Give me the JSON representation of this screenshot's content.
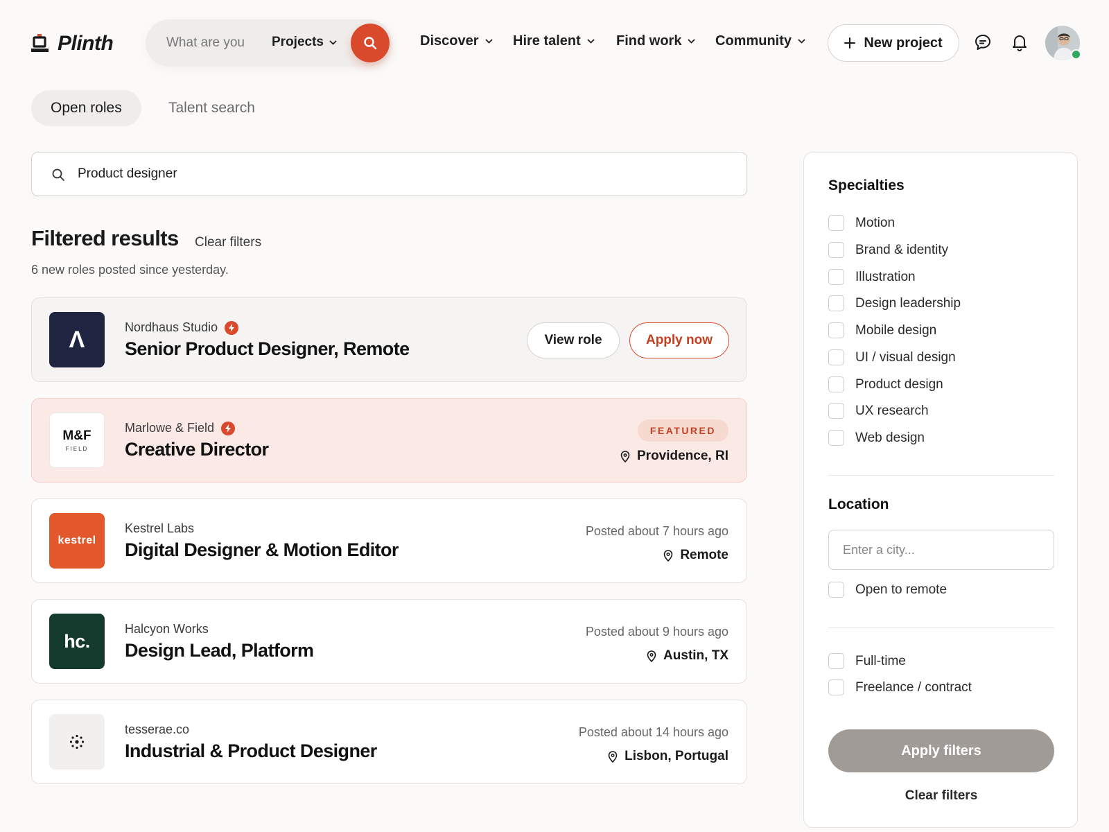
{
  "app": {
    "name": "Plinth"
  },
  "header": {
    "search": {
      "placeholder": "What are you",
      "scope_label": "Projects"
    },
    "nav": [
      {
        "label": "Discover"
      },
      {
        "label": "Hire talent"
      },
      {
        "label": "Find work"
      },
      {
        "label": "Community"
      }
    ],
    "new_project_label": "New project"
  },
  "tabs": [
    {
      "label": "Open roles",
      "active": true
    },
    {
      "label": "Talent search",
      "active": false
    }
  ],
  "main": {
    "search_value": "Product designer",
    "results_title": "Filtered results",
    "clear_filters_label": "Clear filters",
    "subtitle": "6 new roles posted since yesterday."
  },
  "jobs": [
    {
      "company": "Nordhaus Studio",
      "verified": true,
      "title": "Senior Product Designer, Remote",
      "logo_text": "Λ",
      "logo_bg": "#1f2540",
      "view_label": "View role",
      "apply_label": "Apply now"
    },
    {
      "company": "Marlowe & Field",
      "verified": true,
      "title": "Creative Director",
      "logo_text": "M&F",
      "logo_subtext": "FIELD",
      "logo_bg": "#ffffff",
      "badge": "FEATURED",
      "location": "Providence, RI"
    },
    {
      "company": "Kestrel Labs",
      "title": "Digital Designer & Motion Editor",
      "logo_text": "kestrel",
      "logo_bg": "#e2572b",
      "posted": "Posted about 7 hours ago",
      "location": "Remote"
    },
    {
      "company": "Halcyon Works",
      "title": "Design Lead, Platform",
      "logo_text": "hc.",
      "logo_bg": "#143a2e",
      "posted": "Posted about 9 hours ago",
      "location": "Austin, TX"
    },
    {
      "company": "tesserae.co",
      "title": "Industrial & Product Designer",
      "logo_bg": "#f1f0ee",
      "posted": "Posted about 14 hours ago",
      "location": "Lisbon, Portugal"
    }
  ],
  "sidebar": {
    "specialties_title": "Specialties",
    "specialties": [
      {
        "label": "Motion",
        "checked": false
      },
      {
        "label": "Brand & identity",
        "checked": false
      },
      {
        "label": "Illustration",
        "checked": false
      },
      {
        "label": "Design leadership",
        "checked": false
      },
      {
        "label": "Mobile design",
        "checked": false
      },
      {
        "label": "UI / visual design",
        "checked": false
      },
      {
        "label": "Product design",
        "checked": false
      },
      {
        "label": "UX research",
        "checked": false
      },
      {
        "label": "Web design",
        "checked": false
      }
    ],
    "location_title": "Location",
    "city_placeholder": "Enter a city...",
    "open_to_remote_label": "Open to remote",
    "job_types": [
      {
        "label": "Full-time",
        "checked": false
      },
      {
        "label": "Freelance / contract",
        "checked": false
      }
    ],
    "apply_label": "Apply filters",
    "clear_label": "Clear filters"
  },
  "colors": {
    "accent": "#d94a2c",
    "featured_bg": "#fbe9e6",
    "presence": "#2fa860",
    "apply_filters_bg": "#a09b97"
  },
  "icons": {
    "logo": "stamp-icon",
    "search": "search-icon",
    "chevron": "chevron-down-icon",
    "plus": "plus-icon",
    "messages": "chat-bubble-icon",
    "notifications": "bell-icon",
    "location": "map-pin-icon",
    "verified": "bolt-icon"
  }
}
